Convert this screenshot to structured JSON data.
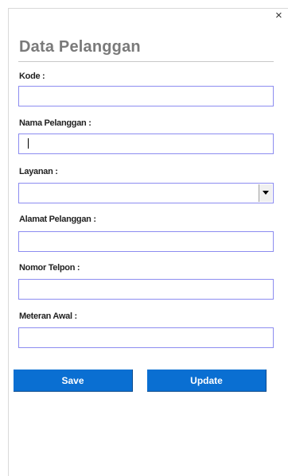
{
  "dialog": {
    "close_glyph": "×",
    "title": "Data Pelanggan"
  },
  "form": {
    "kode": {
      "label": "Kode :",
      "value": ""
    },
    "nama": {
      "label": "Nama Pelanggan :",
      "value": ""
    },
    "layanan": {
      "label": "Layanan :",
      "selected": ""
    },
    "alamat": {
      "label": "Alamat Pelanggan :",
      "value": ""
    },
    "telpon": {
      "label": "Nomor Telpon :",
      "value": ""
    },
    "meteran": {
      "label": "Meteran Awal :",
      "value": ""
    }
  },
  "buttons": {
    "save": "Save",
    "update": "Update"
  },
  "colors": {
    "button_bg": "#0a6fd2",
    "field_border": "#8c8cf0",
    "title": "#7a7a7a"
  },
  "icons": {
    "close": "close-icon",
    "dropdown": "chevron-down-icon"
  }
}
